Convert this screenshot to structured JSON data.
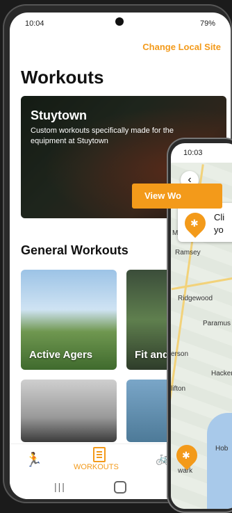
{
  "status": {
    "time": "10:04",
    "right": "79%"
  },
  "header": {
    "change_site": "Change Local Site",
    "title": "Workouts"
  },
  "hero": {
    "title": "Stuytown",
    "description": "Custom workouts specifically made for the equipment at Stuytown",
    "button": "View Wo"
  },
  "general": {
    "title": "General Workouts",
    "cards": [
      {
        "label": "Active Agers"
      },
      {
        "label": "Fit and Health"
      },
      {
        "label": ""
      },
      {
        "label": ""
      }
    ]
  },
  "nav": {
    "workouts_label": "WORKOUTS"
  },
  "phone2": {
    "time": "10:03",
    "info_text": "Cli\nyo",
    "labels": [
      "Mahwah",
      "Ramsey",
      "Ridgewood",
      "Paramus",
      "erson",
      "Hacken",
      "lifton",
      "wark",
      "Hob"
    ]
  },
  "colors": {
    "accent": "#f39a1a"
  },
  "icons": [
    "runner-icon",
    "workouts-icon",
    "bike-icon",
    "back-icon",
    "map-pin-icon"
  ]
}
